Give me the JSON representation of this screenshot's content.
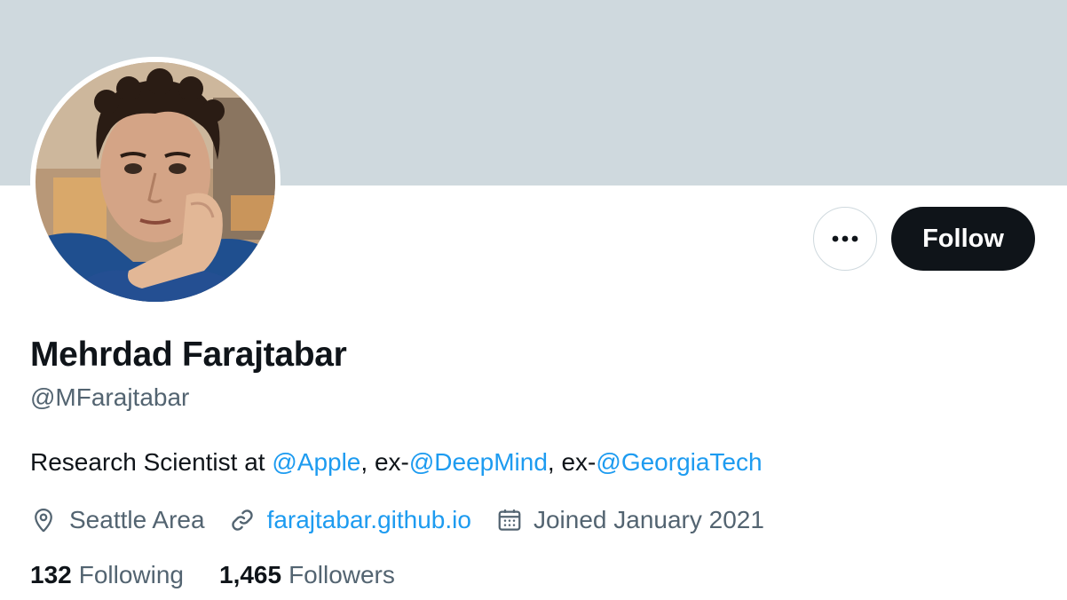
{
  "profile": {
    "name": "Mehrdad Farajtabar",
    "handle": "@MFarajtabar",
    "bio": {
      "prefix": "Research Scientist at ",
      "mention1": "@Apple",
      "sep1": ", ex-",
      "mention2": "@DeepMind",
      "sep2": ", ex-",
      "mention3": "@GeorgiaTech"
    },
    "location": "Seattle Area",
    "website": "farajtabar.github.io",
    "joined": "Joined January 2021",
    "following_count": "132",
    "following_label": "Following",
    "followers_count": "1,465",
    "followers_label": "Followers"
  },
  "actions": {
    "follow_label": "Follow",
    "more_icon": "more-horizontal-icon"
  },
  "colors": {
    "banner": "#cfd9de",
    "accent": "#1d9bf0",
    "primary_text": "#0f1419",
    "secondary_text": "#536471",
    "follow_button": "#0f1419"
  }
}
